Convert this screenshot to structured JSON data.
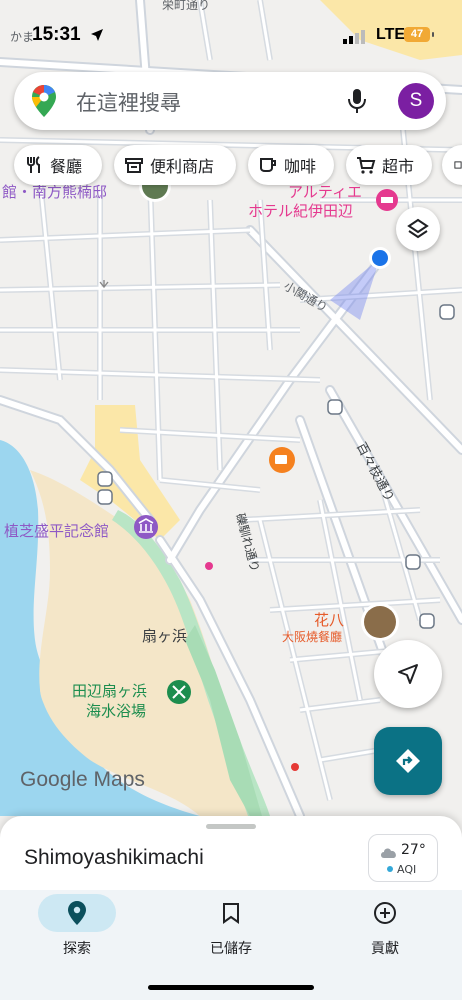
{
  "status_bar": {
    "time": "15:31",
    "carrier": "LTE",
    "battery": "47"
  },
  "search": {
    "placeholder": "在這裡搜尋",
    "avatar_letter": "S"
  },
  "chips": [
    {
      "label": "餐廳",
      "icon": "fork-knife-icon"
    },
    {
      "label": "便利商店",
      "icon": "store-icon"
    },
    {
      "label": "咖啡",
      "icon": "coffee-icon"
    },
    {
      "label": "超市",
      "icon": "cart-icon"
    }
  ],
  "map_labels": {
    "museum_partial": "館・南方熊楠邸",
    "hotel_line1": "アルティエ",
    "hotel_line2": "ホテル紀伊田辺",
    "street_kozeki": "小関通り",
    "street_momoyagi": "百々枝通り",
    "street_kinoshita": "礫馴れ通り",
    "ueshiba": "植芝盛平記念館",
    "ougigahama": "扇ヶ浜",
    "beach_line1": "田辺扇ヶ浜",
    "beach_line2": "海水浴場",
    "hanahachi": "花八",
    "hanahachi_sub": "大阪燒餐廳",
    "top_street": "栄町通り",
    "top_left": "かま",
    "google_maps": "Google Maps"
  },
  "bottom_sheet": {
    "place_name": "Shimoyashikimachi",
    "temperature": "27°",
    "aqi": "AQI"
  },
  "nav": [
    {
      "label": "探索",
      "icon": "explore-pin-icon",
      "active": true
    },
    {
      "label": "已儲存",
      "icon": "bookmark-icon",
      "active": false
    },
    {
      "label": "貢獻",
      "icon": "add-circle-icon",
      "active": false
    }
  ],
  "colors": {
    "accent_teal": "#0b7285",
    "water": "#9cd6ef",
    "park": "#b9e5c5",
    "sand": "#f4e6c8",
    "avatar": "#7b1fa2"
  }
}
